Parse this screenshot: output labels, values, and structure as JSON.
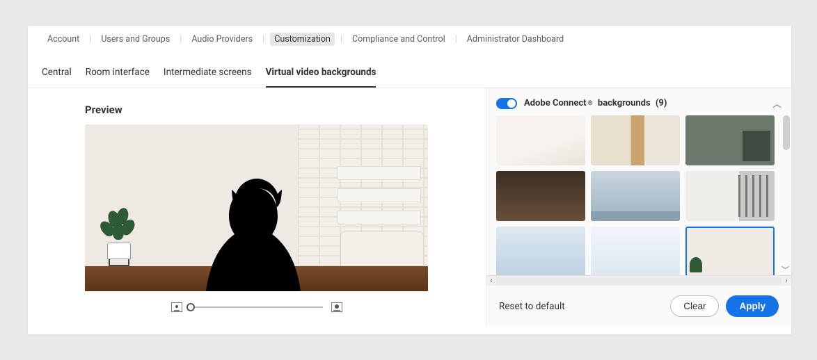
{
  "breadcrumb": {
    "items": [
      "Account",
      "Users and Groups",
      "Audio Providers",
      "Customization",
      "Compliance and Control",
      "Administrator Dashboard"
    ],
    "active_index": 3
  },
  "tabs": {
    "items": [
      "Central",
      "Room interface",
      "Intermediate screens",
      "Virtual video backgrounds"
    ],
    "active_index": 3
  },
  "preview": {
    "title": "Preview"
  },
  "backgrounds": {
    "brand": "Adobe Connect",
    "label_suffix": "backgrounds",
    "count_label": "(9)",
    "enabled": true,
    "selected_index": 8,
    "thumbs": [
      {
        "name": "bright-room-plant"
      },
      {
        "name": "wood-panel-lobby"
      },
      {
        "name": "green-concrete-shelf"
      },
      {
        "name": "industrial-brick-office"
      },
      {
        "name": "glass-open-office"
      },
      {
        "name": "meeting-room-windows"
      },
      {
        "name": "highrise-corner-window"
      },
      {
        "name": "white-skyscraper-view"
      },
      {
        "name": "living-room-white"
      }
    ]
  },
  "footer": {
    "reset": "Reset to default",
    "clear": "Clear",
    "apply": "Apply"
  }
}
